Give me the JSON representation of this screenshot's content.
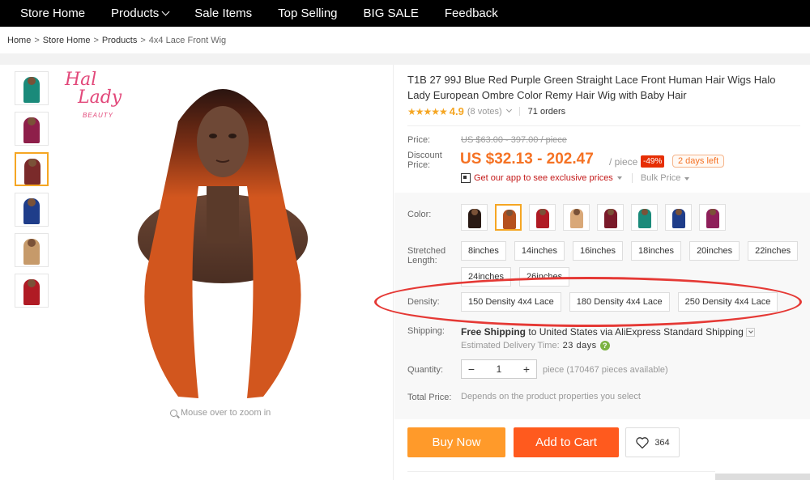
{
  "nav": {
    "items": [
      {
        "label": "Store Home"
      },
      {
        "label": "Products",
        "has_dropdown": true
      },
      {
        "label": "Sale Items"
      },
      {
        "label": "Top Selling"
      },
      {
        "label": "BIG SALE"
      },
      {
        "label": "Feedback"
      }
    ]
  },
  "breadcrumb": {
    "home": "Home",
    "store": "Store Home",
    "products": "Products",
    "current": "4x4 Lace Front Wig",
    "separator": ">"
  },
  "gallery": {
    "logo_line1": "Hal",
    "logo_line2": "Lady",
    "logo_sub": "BEAUTY",
    "zoom_hint": "Mouse over to zoom in",
    "thumbnails": [
      {
        "color": "#1a8a7a"
      },
      {
        "color": "#8e1f4a"
      },
      {
        "color": "#7a2a2a",
        "active": true
      },
      {
        "color": "#1f3d8a"
      },
      {
        "color": "#c69a6a"
      },
      {
        "color": "#b01b24"
      }
    ],
    "main_hair_color": "#d2561e"
  },
  "product": {
    "title": "T1B 27 99J Blue Red Purple Green Straight Lace Front Human Hair Wigs Halo Lady European Ombre Color Remy Hair Wig with Baby Hair",
    "stars": "★★★★★",
    "rating": "4.9",
    "votes": "(8 votes)",
    "orders": "71 orders"
  },
  "price": {
    "price_label": "Price:",
    "original": "US $63.00 - 397.00 / piece",
    "discount_label": "Discount Price:",
    "discount": "US $32.13 - 202.47",
    "per_piece": "/ piece",
    "off": "-49%",
    "days_left": "2 days left",
    "app_link": "Get our app to see exclusive prices",
    "bulk": "Bulk Price"
  },
  "options": {
    "color_label": "Color:",
    "color_swatches": [
      {
        "hair": "#2a1a14"
      },
      {
        "hair": "#b5501e",
        "active": true
      },
      {
        "hair": "#b01b24"
      },
      {
        "hair": "#d9a878"
      },
      {
        "hair": "#7a1a2a"
      },
      {
        "hair": "#1a8a7a"
      },
      {
        "hair": "#1f3d8a"
      },
      {
        "hair": "#8e1f5a"
      }
    ],
    "length_label": "Stretched Length:",
    "lengths": [
      "8inches",
      "14inches",
      "16inches",
      "18inches",
      "20inches",
      "22inches",
      "24inches",
      "26inches"
    ],
    "density_label": "Density:",
    "densities": [
      "150 Density 4x4 Lace",
      "180 Density 4x4 Lace",
      "250 Density 4x4 Lace"
    ],
    "annotation_color": "#e53935"
  },
  "shipping": {
    "label": "Shipping:",
    "free": "Free Shipping",
    "to": "to United States via AliExpress Standard Shipping",
    "est_label": "Estimated Delivery Time:",
    "est_days": "23 days"
  },
  "quantity": {
    "label": "Quantity:",
    "minus": "−",
    "value": "1",
    "plus": "+",
    "note": "piece (170467 pieces available)"
  },
  "total": {
    "label": "Total Price:",
    "note": "Depends on the product properties you select"
  },
  "actions": {
    "buy_now": "Buy Now",
    "add_to_cart": "Add to Cart",
    "wishlist_count": "364"
  },
  "colors": {
    "accent_orange": "#f57224",
    "buy_now": "#ff9a2a",
    "add_to_cart": "#ff5a1e",
    "star": "#f5a623"
  }
}
